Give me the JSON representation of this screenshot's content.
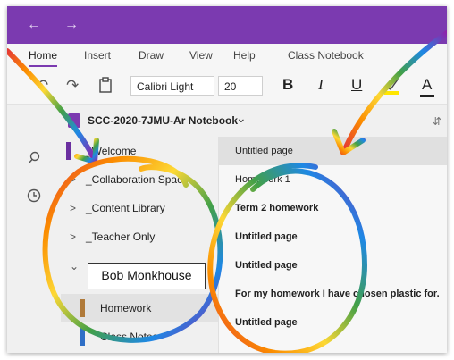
{
  "window": {
    "back_arrow": "←",
    "forward_arrow": "→",
    "accent_color": "#7b3ab0"
  },
  "ribbon": {
    "tabs": [
      {
        "label": "Home",
        "active": true
      },
      {
        "label": "Insert"
      },
      {
        "label": "Draw"
      },
      {
        "label": "View"
      },
      {
        "label": "Help"
      },
      {
        "label": "Class Notebook"
      }
    ],
    "font_name": "Calibri Light",
    "font_size": "20",
    "bold": "B",
    "italic": "I",
    "underline": "U",
    "font_color": "A"
  },
  "notebook": {
    "title": "SCC-2020-7JMU-Ar Notebook",
    "dropdown_glyph": "⌄"
  },
  "sections": {
    "items": [
      {
        "label": "_Welcome",
        "color": "#6b2fa0"
      },
      {
        "label": "_Collaboration Space",
        "chevron": ">"
      },
      {
        "label": "_Content Library",
        "chevron": ">"
      },
      {
        "label": "_Teacher Only",
        "chevron": ">"
      },
      {
        "label": "Bob Monkhouse",
        "chevron": "⌄"
      },
      {
        "label": "Homework",
        "color": "#b07a3a",
        "selected": true
      },
      {
        "label": "Class Notes",
        "color": "#2f6fc6"
      }
    ]
  },
  "pages": {
    "items": [
      {
        "label": "Untitled page",
        "selected": true
      },
      {
        "label": "Homework 1"
      },
      {
        "label": "Term 2 homework"
      },
      {
        "label": "Untitled page"
      },
      {
        "label": "Untitled page"
      },
      {
        "label": "For my homework I have chosen plastic for."
      },
      {
        "label": "Untitled page"
      }
    ]
  },
  "annotation": {
    "callout": "Bob Monkhouse"
  },
  "icons": {
    "undo": "undo-icon",
    "redo": "redo-icon",
    "clipboard": "clipboard-icon",
    "highlighter": "highlighter-icon",
    "library": "notebooks-icon",
    "search": "search-icon",
    "recent": "clock-icon"
  }
}
